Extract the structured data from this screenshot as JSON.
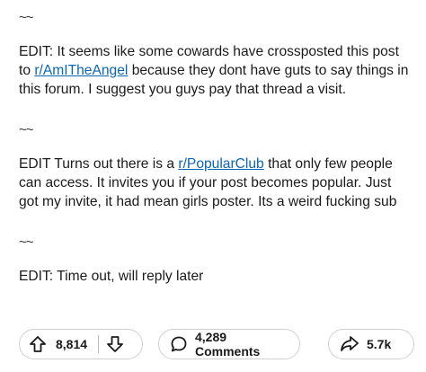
{
  "post": {
    "separators": [
      "~~",
      "~~",
      "~~",
      "~~"
    ],
    "edit1": {
      "before": "EDIT: It seems like some cowards have crossposted this post to ",
      "link": "r/AmITheAngel",
      "after": " because they dont have guts to say things in this forum. I suggest you guys pay that thread a visit."
    },
    "edit2": {
      "before": "EDIT Turns out there is a ",
      "link": "r/PopularClub",
      "after": " that only few people can access. It invites you if your post becomes popular. Just got my invite, it had mean girls poster. Its a weird fucking sub"
    },
    "edit3": "EDIT: Time out, will reply later"
  },
  "actions": {
    "votes": "8,814",
    "comments": "4,289 Comments",
    "shares": "5.7k",
    "icons": {
      "upvote": "upvote-arrow-icon",
      "downvote": "downvote-arrow-icon",
      "comment": "comment-bubble-icon",
      "share": "share-arrow-icon"
    }
  },
  "colors": {
    "link": "#0a66b2",
    "border": "#cfcfcf",
    "text": "#1a1a1b"
  }
}
